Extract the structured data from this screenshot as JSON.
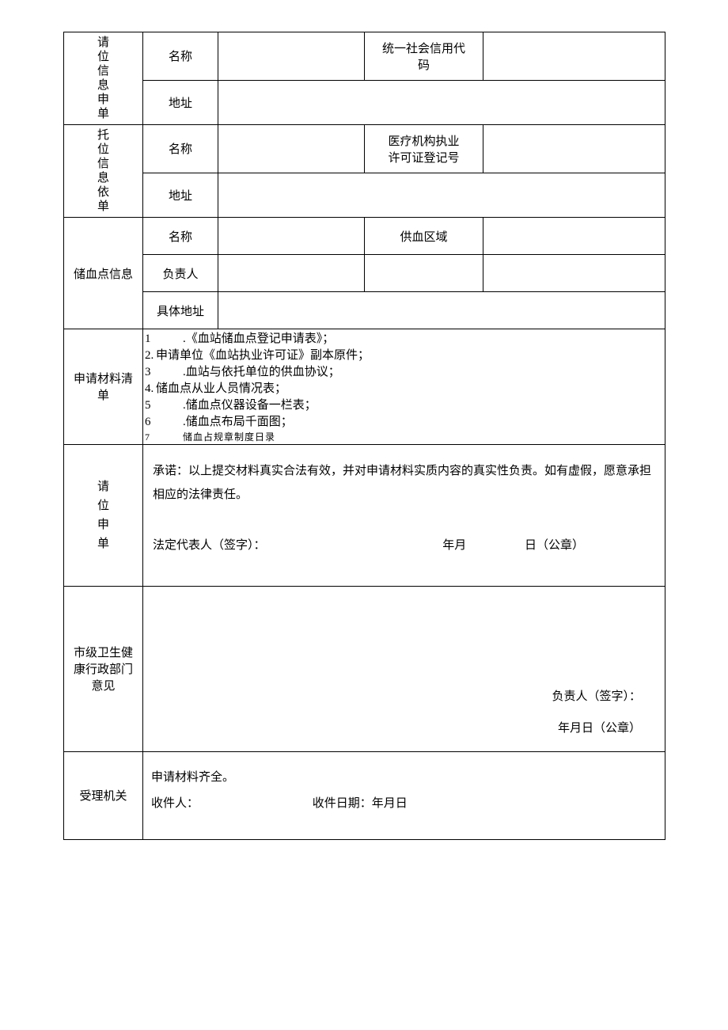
{
  "rows": {
    "applicant": {
      "header_chars": [
        "请",
        "位",
        "信",
        "息",
        "申",
        "单"
      ],
      "name_label": "名称",
      "code_label_l1": "统一社会信用代",
      "code_label_l2": "码",
      "addr_label": "地址"
    },
    "trustee": {
      "header_chars": [
        "托",
        "位",
        "信",
        "息",
        "依",
        "单"
      ],
      "name_label": "名称",
      "perm_label_l1": "医疗机构执业",
      "perm_label_l2": "许可证登记号",
      "addr_label": "地址"
    },
    "storage": {
      "header": "储血点信息",
      "name_label": "名称",
      "area_label": "供血区域",
      "leader_label": "负责人",
      "addr_label": "具体地址"
    },
    "materials": {
      "header_l1": "申请材料清",
      "header_l2": "单",
      "items": [
        {
          "num": "1",
          "gap": true,
          "text": ".《血站储血点登记申请表》；"
        },
        {
          "num": "2.",
          "gap": false,
          "text": "申请单位《血站执业许可证》副本原件；"
        },
        {
          "num": "3",
          "gap": true,
          "text": ".血站与依托单位的供血协议；"
        },
        {
          "num": "4.",
          "gap": false,
          "text": "储血点从业人员情况表；"
        },
        {
          "num": "5",
          "gap": true,
          "text": ".储血点仪器设备一栏表；"
        },
        {
          "num": "6",
          "gap": true,
          "text": ".储血点布局千面图；"
        }
      ],
      "cutline": {
        "num": "7",
        "text": "储血占规章制度日录"
      }
    },
    "promise": {
      "header_chars": [
        "请",
        "位",
        "申",
        "单"
      ],
      "text": "承诺：以上提交材料真实合法有效，并对申请材料实质内容的真实性负责。如有虚假，愿意承担相应的法律责任。",
      "sig_label": "法定代表人（签字）：",
      "ym": "年月",
      "d": "日（公章）"
    },
    "city": {
      "header_l1": "市级卫生健",
      "header_l2": "康行政部门",
      "header_l3": "意见",
      "sign": "负责人（签字）：",
      "date": "年月日（公章）"
    },
    "accept": {
      "header": "受理机关",
      "line1": "申请材料齐全。",
      "recv": "收件人：",
      "rdate": "收件日期：年月日"
    }
  }
}
